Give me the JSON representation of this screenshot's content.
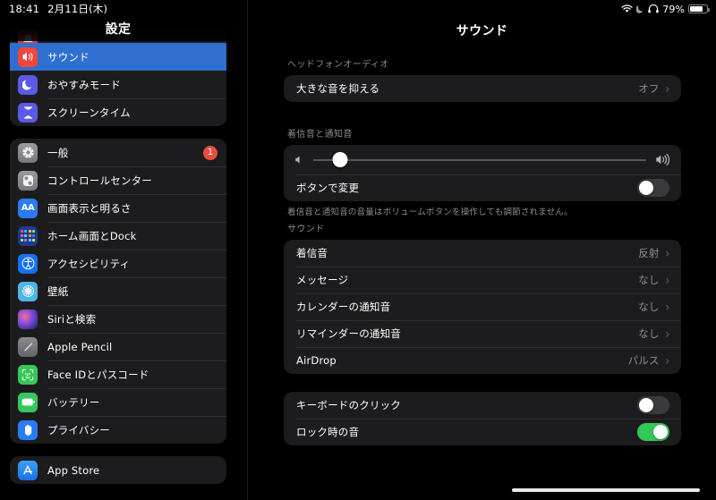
{
  "status_bar": {
    "time": "18:41",
    "date": "2月11日(木)",
    "battery_percent": "79%",
    "icons": [
      "wifi-icon",
      "moon-icon",
      "headphones-icon",
      "battery-icon"
    ]
  },
  "sidebar": {
    "title": "設定",
    "groups": [
      {
        "clipped_top": true,
        "items": [
          {
            "label": "",
            "icon": "notifications-icon",
            "icon_class": "ic-sound",
            "glyph": "",
            "clipped": true,
            "selected": false,
            "badge": ""
          },
          {
            "label": "サウンド",
            "icon": "sound-icon",
            "icon_class": "ic-sound",
            "glyph": "🔊",
            "selected": true,
            "badge": ""
          },
          {
            "label": "おやすみモード",
            "icon": "do-not-disturb-icon",
            "icon_class": "ic-dnd",
            "glyph": "🌙",
            "selected": false,
            "badge": ""
          },
          {
            "label": "スクリーンタイム",
            "icon": "screen-time-icon",
            "icon_class": "ic-screen",
            "glyph": "⌛",
            "selected": false,
            "badge": ""
          }
        ]
      },
      {
        "clipped_top": false,
        "items": [
          {
            "label": "一般",
            "icon": "gear-icon",
            "icon_class": "ic-general",
            "glyph": "⚙",
            "selected": false,
            "badge": "1"
          },
          {
            "label": "コントロールセンター",
            "icon": "control-center-icon",
            "icon_class": "ic-control",
            "glyph": "◨",
            "selected": false,
            "badge": ""
          },
          {
            "label": "画面表示と明るさ",
            "icon": "display-brightness-icon",
            "icon_class": "ic-display",
            "glyph": "AA",
            "selected": false,
            "badge": ""
          },
          {
            "label": "ホーム画面とDock",
            "icon": "home-screen-dock-icon",
            "icon_class": "ic-home",
            "glyph": "",
            "selected": false,
            "badge": ""
          },
          {
            "label": "アクセシビリティ",
            "icon": "accessibility-icon",
            "icon_class": "ic-access",
            "glyph": "♿",
            "selected": false,
            "badge": ""
          },
          {
            "label": "壁紙",
            "icon": "wallpaper-icon",
            "icon_class": "ic-wall",
            "glyph": "✳",
            "selected": false,
            "badge": ""
          },
          {
            "label": "Siriと検索",
            "icon": "siri-icon",
            "icon_class": "ic-siri",
            "glyph": "",
            "selected": false,
            "badge": ""
          },
          {
            "label": "Apple Pencil",
            "icon": "apple-pencil-icon",
            "icon_class": "ic-pencil",
            "glyph": "✎",
            "selected": false,
            "badge": ""
          },
          {
            "label": "Face IDとパスコード",
            "icon": "face-id-icon",
            "icon_class": "ic-faceid",
            "glyph": "☺",
            "selected": false,
            "badge": ""
          },
          {
            "label": "バッテリー",
            "icon": "battery-icon",
            "icon_class": "ic-batt",
            "glyph": "▭",
            "selected": false,
            "badge": ""
          },
          {
            "label": "プライバシー",
            "icon": "privacy-hand-icon",
            "icon_class": "ic-privacy",
            "glyph": "✋",
            "selected": false,
            "badge": ""
          }
        ]
      },
      {
        "clipped_top": false,
        "items": [
          {
            "label": "App Store",
            "icon": "app-store-icon",
            "icon_class": "ic-appstore",
            "glyph": "A",
            "selected": false,
            "badge": ""
          }
        ]
      }
    ]
  },
  "detail": {
    "title": "サウンド",
    "headphone_section": {
      "header": "ヘッドフォンオーディオ",
      "rows": [
        {
          "label": "大きな音を抑える",
          "value": "オフ",
          "type": "disclosure"
        }
      ]
    },
    "ringer_section": {
      "header": "着信音と通知音",
      "slider": {
        "name": "ringer-volume-slider",
        "value_percent": 8,
        "min_icon": "volume-low-icon",
        "max_icon": "volume-high-icon"
      },
      "toggle_row": {
        "label": "ボタンで変更",
        "state": "off"
      },
      "footer": "着信音と通知音の音量はボリュームボタンを操作しても調節されません。"
    },
    "sounds_section": {
      "header": "サウンド",
      "rows": [
        {
          "label": "着信音",
          "value": "反射",
          "type": "disclosure"
        },
        {
          "label": "メッセージ",
          "value": "なし",
          "type": "disclosure"
        },
        {
          "label": "カレンダーの通知音",
          "value": "なし",
          "type": "disclosure"
        },
        {
          "label": "リマインダーの通知音",
          "value": "なし",
          "type": "disclosure"
        },
        {
          "label": "AirDrop",
          "value": "パルス",
          "type": "disclosure"
        }
      ]
    },
    "toggles_section": {
      "rows": [
        {
          "label": "キーボードのクリック",
          "state": "off"
        },
        {
          "label": "ロック時の音",
          "state": "on"
        }
      ]
    },
    "chevron_glyph": "›"
  },
  "colors": {
    "accent_selected": "#2f6fd0",
    "card_bg": "#1c1c1e",
    "page_bg": "#000000",
    "toggle_on": "#34c759",
    "badge_red": "#eb4d3d",
    "secondary_text": "#8d8d93"
  }
}
